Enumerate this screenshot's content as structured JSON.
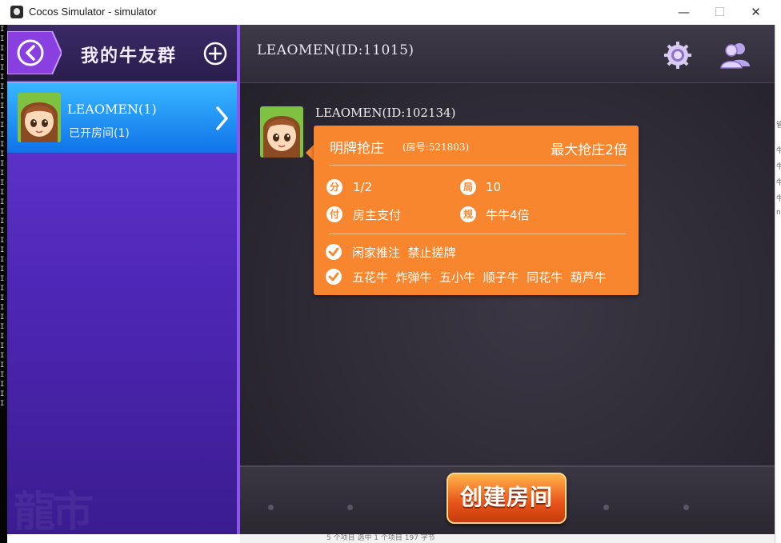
{
  "window": {
    "title": "Cocos Simulator - simulator",
    "minimize": "—",
    "maximize": "☐",
    "close": "✕"
  },
  "sidebar": {
    "title": "我的牛友群",
    "groups": [
      {
        "name": "LEAOMEN(1)",
        "subtitle": "已开房间(1)"
      }
    ]
  },
  "header": {
    "title": "LEAOMEN(ID:11015)"
  },
  "room": {
    "owner": "LEAOMEN(ID:102134)",
    "mode": "明牌抢庄",
    "room_no": "(房号:521803)",
    "max_grab": "最大抢庄2倍",
    "details": [
      {
        "icon_char": "分",
        "value": "1/2"
      },
      {
        "icon_char": "局",
        "value": "10"
      },
      {
        "icon_char": "付",
        "value": "房主支付"
      },
      {
        "icon_char": "规",
        "value": "牛牛4倍"
      }
    ],
    "options": [
      "闲家推注  禁止搓牌",
      "五花牛  炸弹牛  五小牛  顺子牛  同花牛  葫芦牛"
    ]
  },
  "footer": {
    "create_label": "创建房间"
  },
  "background_text": {
    "left_strip": [
      "I",
      "I",
      "I",
      "I",
      "I",
      "I",
      "I",
      "I",
      "I",
      "I",
      "I",
      "I",
      "I",
      "I",
      "I",
      "I",
      "I",
      "I",
      "I",
      "I",
      "I",
      "I",
      "I",
      "I",
      "I",
      "I",
      "I",
      "I",
      "I",
      "I",
      "I",
      "I",
      "I",
      "I",
      "I",
      "I",
      "I",
      "I",
      "I",
      "I"
    ],
    "right_strip": [
      "管",
      "牛",
      "牛",
      "牛",
      "牛",
      "n"
    ],
    "status_bar": "5 个项目    选中 1 个项目  197 字节",
    "watermark": "龍市"
  },
  "colors": {
    "accent_purple": "#6a3bd6",
    "selected_blue": "#1e8df3",
    "card_orange": "#f7862f",
    "button_orange": "#e8531a"
  }
}
